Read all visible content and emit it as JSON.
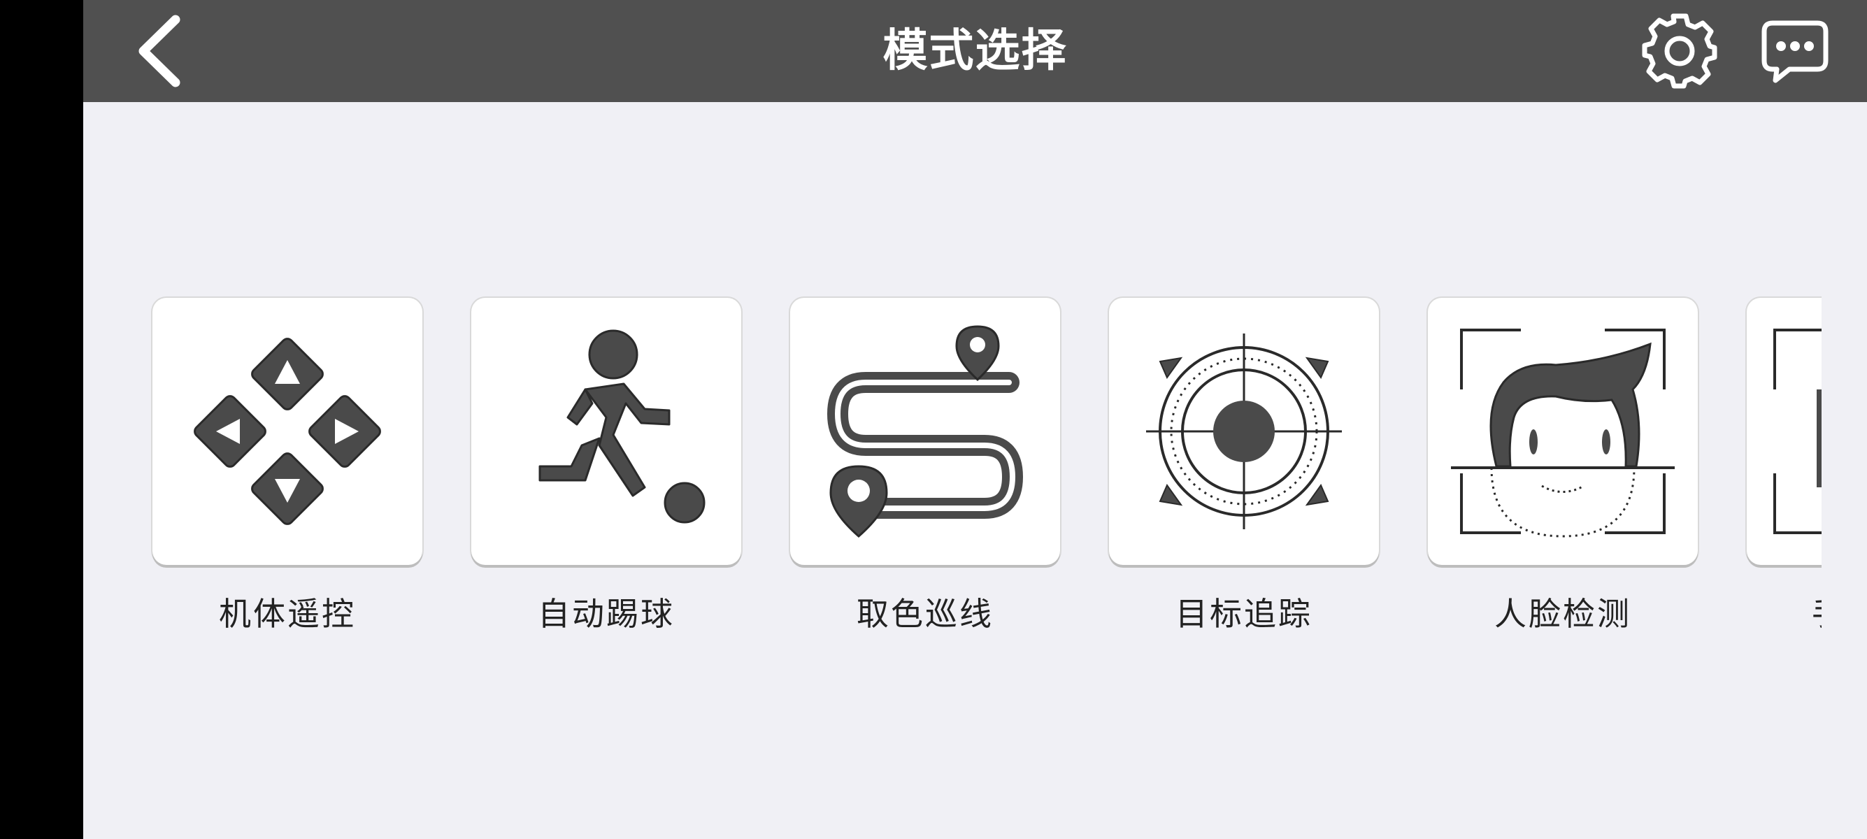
{
  "header": {
    "title": "模式选择",
    "back_icon": "chevron-left-icon",
    "settings_icon": "gear-icon",
    "message_icon": "chat-bubble-icon"
  },
  "colors": {
    "topbar": "#505050",
    "background": "#f0f0f5",
    "tile": "#ffffff",
    "icon_dark": "#4a4a4a"
  },
  "modes": [
    {
      "label": "机体遥控",
      "icon": "dpad-arrows-icon"
    },
    {
      "label": "自动踢球",
      "icon": "soccer-kick-icon"
    },
    {
      "label": "取色巡线",
      "icon": "route-path-icon"
    },
    {
      "label": "目标追踪",
      "icon": "target-crosshair-icon"
    },
    {
      "label": "人脸检测",
      "icon": "face-detect-icon"
    },
    {
      "label": "手",
      "icon": "partial-tile-icon"
    }
  ]
}
